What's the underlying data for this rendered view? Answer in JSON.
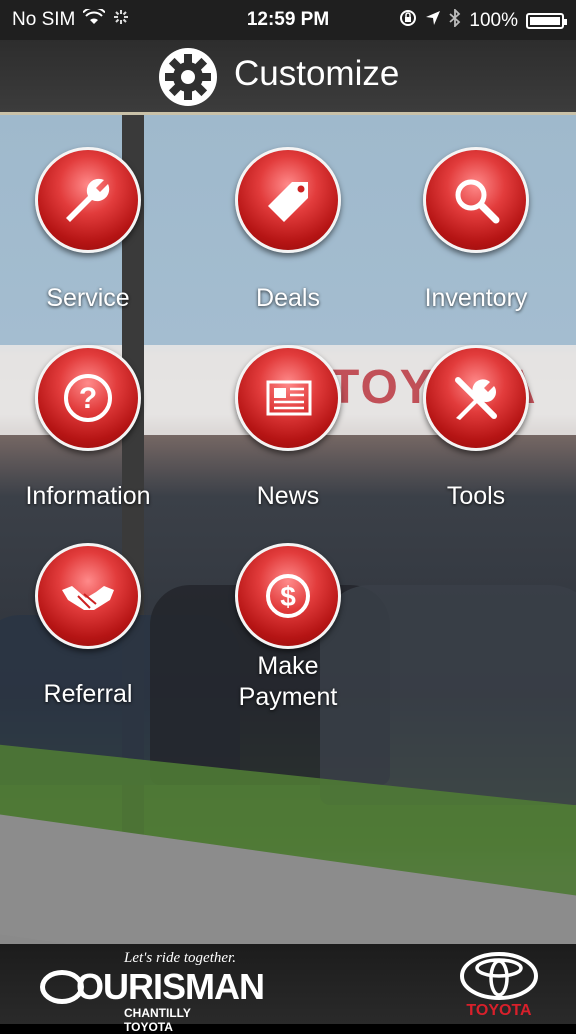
{
  "status_bar": {
    "carrier": "No SIM",
    "time": "12:59 PM",
    "battery": "100%",
    "icons": [
      "wifi-icon",
      "activity-icon",
      "orientation-lock-icon",
      "location-arrow-icon",
      "bluetooth-icon",
      "battery-icon"
    ]
  },
  "header": {
    "title": "Customize",
    "icon": "gear-icon"
  },
  "menu": {
    "items": [
      {
        "label": "Service",
        "icon": "wrench-icon"
      },
      {
        "label": "Deals",
        "icon": "price-tag-icon"
      },
      {
        "label": "Inventory",
        "icon": "magnifier-icon"
      },
      {
        "label": "Information",
        "icon": "question-icon"
      },
      {
        "label": "News",
        "icon": "newspaper-icon"
      },
      {
        "label": "Tools",
        "icon": "tools-icon"
      },
      {
        "label": "Referral",
        "icon": "handshake-icon"
      },
      {
        "label": "Make Payment",
        "icon": "dollar-icon"
      }
    ]
  },
  "background": {
    "sign_text": "TOYOTA"
  },
  "footer": {
    "dealer_tagline": "Let's ride together.",
    "dealer_name": "OURISMAN",
    "dealer_sub": "CHANTILLY TOYOTA",
    "brand_name": "TOYOTA",
    "colors": {
      "button_red": "#d42b2b",
      "toyota_red": "#d8202b"
    }
  }
}
